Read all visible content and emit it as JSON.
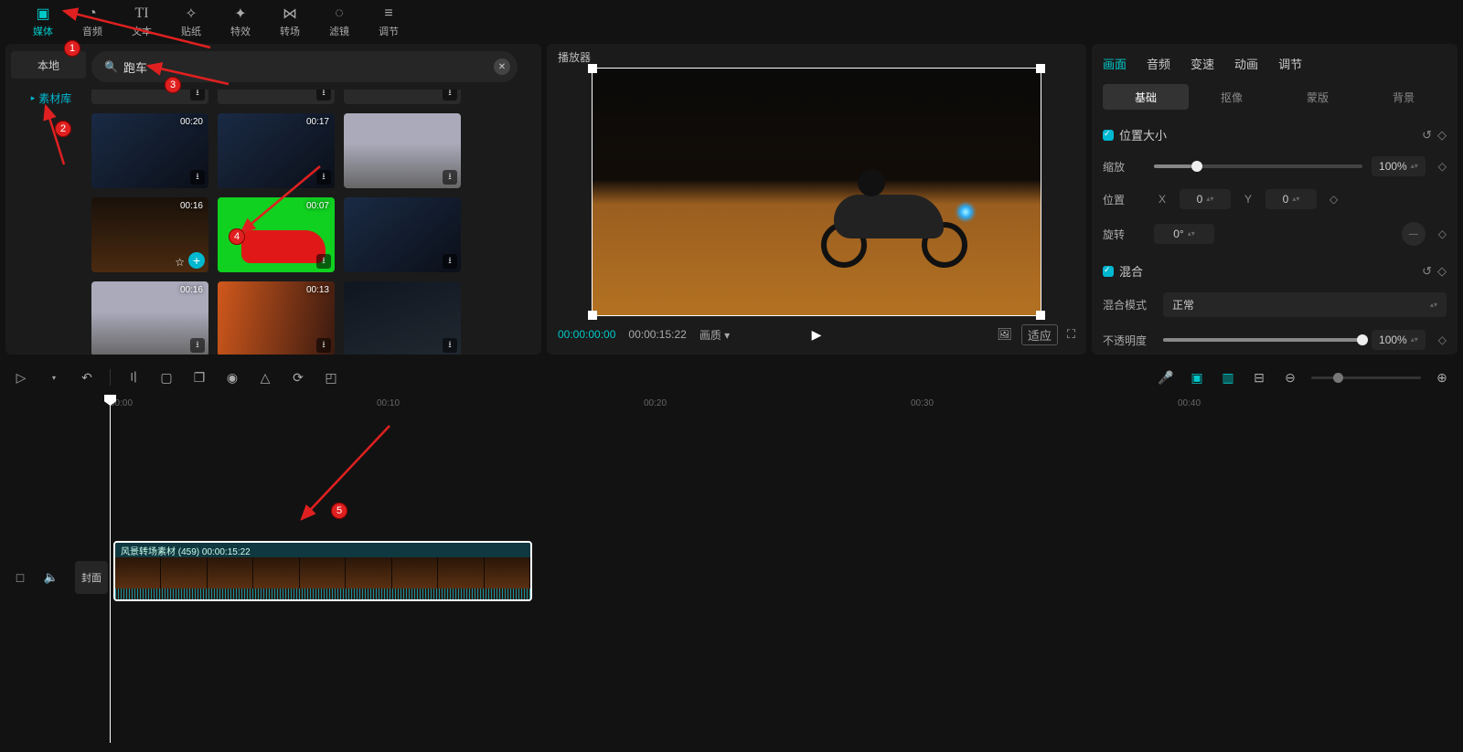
{
  "topTabs": {
    "media": "媒体",
    "audio": "音频",
    "text": "文本",
    "sticker": "贴纸",
    "effect": "特效",
    "transition": "转场",
    "filter": "滤镜",
    "adjust": "调节"
  },
  "leftSide": {
    "local": "本地",
    "library": "素材库"
  },
  "search": {
    "value": "跑车"
  },
  "clips": {
    "r2": [
      "00:20",
      "00:17",
      ""
    ],
    "r3": [
      "00:16",
      "00:07",
      ""
    ],
    "r4": [
      "00:16",
      "00:13",
      ""
    ]
  },
  "player": {
    "title": "播放器",
    "current": "00:00:00:00",
    "total": "00:00:15:22",
    "quality": "画质",
    "ratio": "适应"
  },
  "inspector": {
    "tabs": {
      "picture": "画面",
      "audio": "音频",
      "speed": "变速",
      "anim": "动画",
      "adjust": "调节"
    },
    "subTabs": {
      "basic": "基础",
      "cutout": "抠像",
      "mask": "蒙版",
      "bg": "背景"
    },
    "groupTransform": "位置大小",
    "scale": {
      "label": "缩放",
      "value": "100%"
    },
    "position": {
      "label": "位置",
      "xLabel": "X",
      "y": "Y",
      "xVal": "0",
      "yVal": "0"
    },
    "rotate": {
      "label": "旋转",
      "value": "0°"
    },
    "groupBlend": "混合",
    "blendMode": {
      "label": "混合模式",
      "value": "正常"
    },
    "opacity": {
      "label": "不透明度",
      "value": "100%"
    }
  },
  "ruler": {
    "t0": "00:00",
    "t10": "00:10",
    "t20": "00:20",
    "t30": "00:30",
    "t40": "00:40"
  },
  "timeline": {
    "coverBtn": "封面",
    "clipLabel": "风景转场素材 (459)    00:00:15:22"
  },
  "annotations": {
    "a1": "1",
    "a2": "2",
    "a3": "3",
    "a4": "4",
    "a5": "5"
  }
}
